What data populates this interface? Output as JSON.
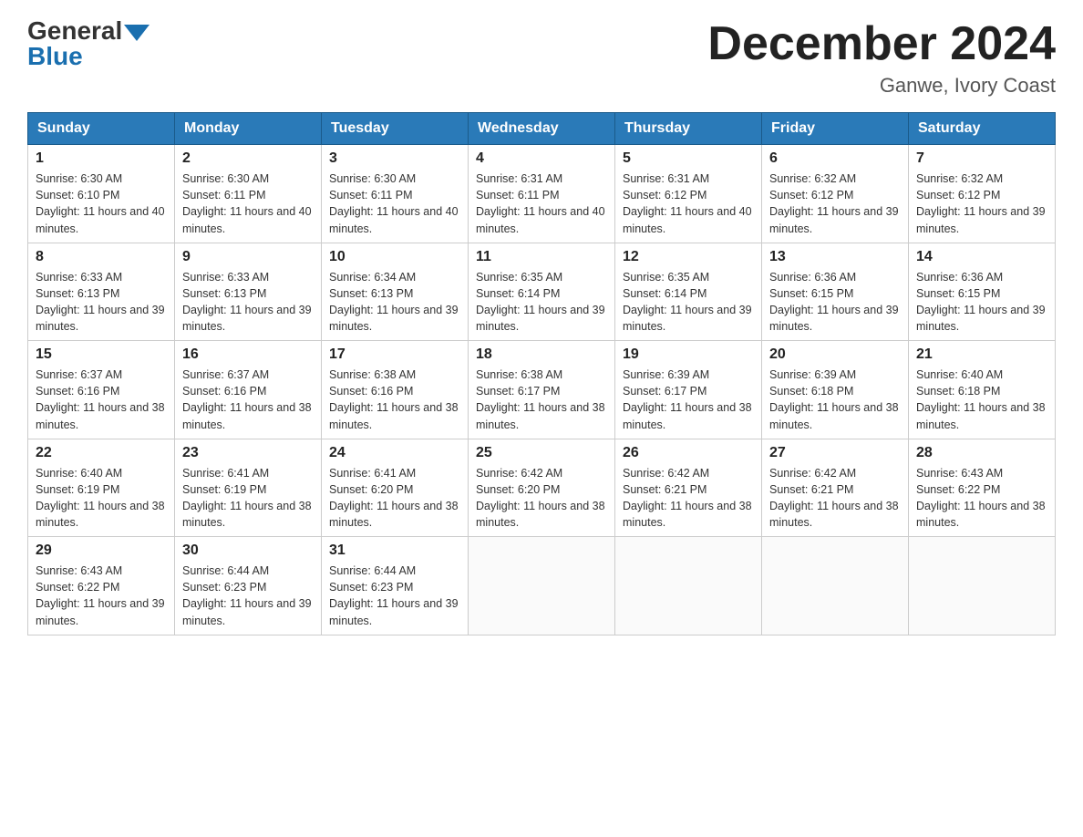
{
  "logo": {
    "general": "General",
    "blue": "Blue"
  },
  "header": {
    "title": "December 2024",
    "subtitle": "Ganwe, Ivory Coast"
  },
  "weekdays": [
    "Sunday",
    "Monday",
    "Tuesday",
    "Wednesday",
    "Thursday",
    "Friday",
    "Saturday"
  ],
  "weeks": [
    [
      {
        "day": "1",
        "sunrise": "6:30 AM",
        "sunset": "6:10 PM",
        "daylight": "11 hours and 40 minutes."
      },
      {
        "day": "2",
        "sunrise": "6:30 AM",
        "sunset": "6:11 PM",
        "daylight": "11 hours and 40 minutes."
      },
      {
        "day": "3",
        "sunrise": "6:30 AM",
        "sunset": "6:11 PM",
        "daylight": "11 hours and 40 minutes."
      },
      {
        "day": "4",
        "sunrise": "6:31 AM",
        "sunset": "6:11 PM",
        "daylight": "11 hours and 40 minutes."
      },
      {
        "day": "5",
        "sunrise": "6:31 AM",
        "sunset": "6:12 PM",
        "daylight": "11 hours and 40 minutes."
      },
      {
        "day": "6",
        "sunrise": "6:32 AM",
        "sunset": "6:12 PM",
        "daylight": "11 hours and 39 minutes."
      },
      {
        "day": "7",
        "sunrise": "6:32 AM",
        "sunset": "6:12 PM",
        "daylight": "11 hours and 39 minutes."
      }
    ],
    [
      {
        "day": "8",
        "sunrise": "6:33 AM",
        "sunset": "6:13 PM",
        "daylight": "11 hours and 39 minutes."
      },
      {
        "day": "9",
        "sunrise": "6:33 AM",
        "sunset": "6:13 PM",
        "daylight": "11 hours and 39 minutes."
      },
      {
        "day": "10",
        "sunrise": "6:34 AM",
        "sunset": "6:13 PM",
        "daylight": "11 hours and 39 minutes."
      },
      {
        "day": "11",
        "sunrise": "6:35 AM",
        "sunset": "6:14 PM",
        "daylight": "11 hours and 39 minutes."
      },
      {
        "day": "12",
        "sunrise": "6:35 AM",
        "sunset": "6:14 PM",
        "daylight": "11 hours and 39 minutes."
      },
      {
        "day": "13",
        "sunrise": "6:36 AM",
        "sunset": "6:15 PM",
        "daylight": "11 hours and 39 minutes."
      },
      {
        "day": "14",
        "sunrise": "6:36 AM",
        "sunset": "6:15 PM",
        "daylight": "11 hours and 39 minutes."
      }
    ],
    [
      {
        "day": "15",
        "sunrise": "6:37 AM",
        "sunset": "6:16 PM",
        "daylight": "11 hours and 38 minutes."
      },
      {
        "day": "16",
        "sunrise": "6:37 AM",
        "sunset": "6:16 PM",
        "daylight": "11 hours and 38 minutes."
      },
      {
        "day": "17",
        "sunrise": "6:38 AM",
        "sunset": "6:16 PM",
        "daylight": "11 hours and 38 minutes."
      },
      {
        "day": "18",
        "sunrise": "6:38 AM",
        "sunset": "6:17 PM",
        "daylight": "11 hours and 38 minutes."
      },
      {
        "day": "19",
        "sunrise": "6:39 AM",
        "sunset": "6:17 PM",
        "daylight": "11 hours and 38 minutes."
      },
      {
        "day": "20",
        "sunrise": "6:39 AM",
        "sunset": "6:18 PM",
        "daylight": "11 hours and 38 minutes."
      },
      {
        "day": "21",
        "sunrise": "6:40 AM",
        "sunset": "6:18 PM",
        "daylight": "11 hours and 38 minutes."
      }
    ],
    [
      {
        "day": "22",
        "sunrise": "6:40 AM",
        "sunset": "6:19 PM",
        "daylight": "11 hours and 38 minutes."
      },
      {
        "day": "23",
        "sunrise": "6:41 AM",
        "sunset": "6:19 PM",
        "daylight": "11 hours and 38 minutes."
      },
      {
        "day": "24",
        "sunrise": "6:41 AM",
        "sunset": "6:20 PM",
        "daylight": "11 hours and 38 minutes."
      },
      {
        "day": "25",
        "sunrise": "6:42 AM",
        "sunset": "6:20 PM",
        "daylight": "11 hours and 38 minutes."
      },
      {
        "day": "26",
        "sunrise": "6:42 AM",
        "sunset": "6:21 PM",
        "daylight": "11 hours and 38 minutes."
      },
      {
        "day": "27",
        "sunrise": "6:42 AM",
        "sunset": "6:21 PM",
        "daylight": "11 hours and 38 minutes."
      },
      {
        "day": "28",
        "sunrise": "6:43 AM",
        "sunset": "6:22 PM",
        "daylight": "11 hours and 38 minutes."
      }
    ],
    [
      {
        "day": "29",
        "sunrise": "6:43 AM",
        "sunset": "6:22 PM",
        "daylight": "11 hours and 39 minutes."
      },
      {
        "day": "30",
        "sunrise": "6:44 AM",
        "sunset": "6:23 PM",
        "daylight": "11 hours and 39 minutes."
      },
      {
        "day": "31",
        "sunrise": "6:44 AM",
        "sunset": "6:23 PM",
        "daylight": "11 hours and 39 minutes."
      },
      null,
      null,
      null,
      null
    ]
  ]
}
